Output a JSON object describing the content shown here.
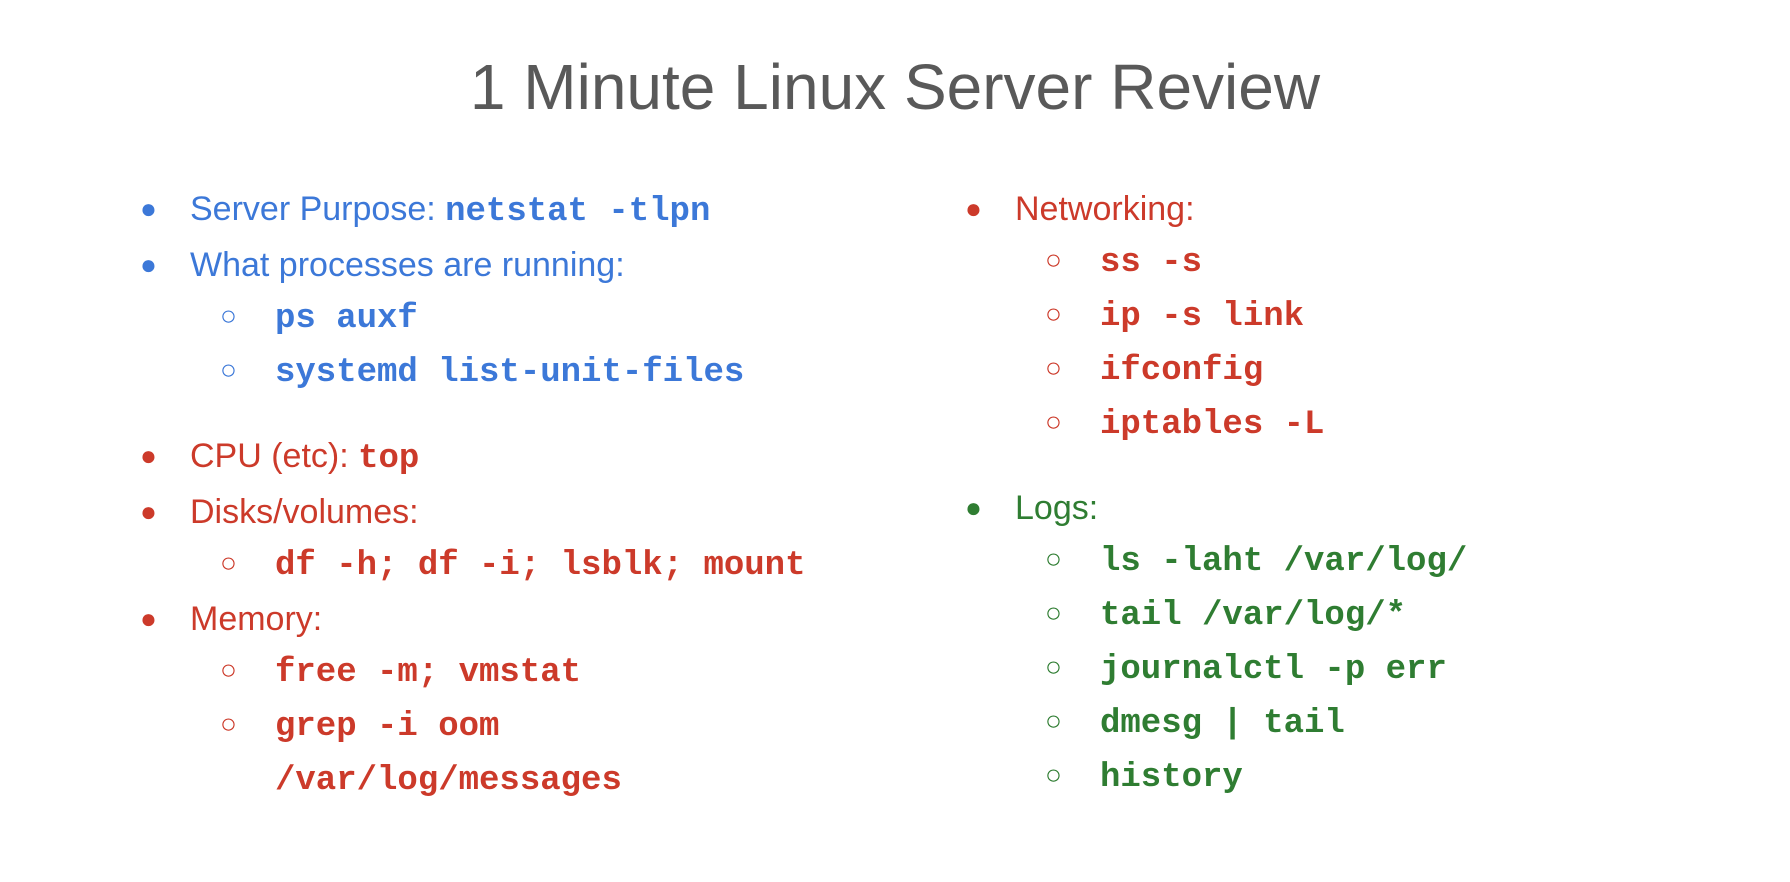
{
  "title": "1 Minute Linux Server Review",
  "colors": {
    "blue": "#3c78d8",
    "red": "#cc3a2a",
    "green": "#2f7d32",
    "title_gray": "#595959"
  },
  "left": {
    "blue": {
      "server_purpose_label": "Server Purpose: ",
      "server_purpose_cmd": "netstat -tlpn",
      "processes_label": "What processes are running:",
      "processes_cmds": {
        "ps": "ps auxf",
        "systemd": "systemd list-unit-files"
      }
    },
    "red": {
      "cpu_label": "CPU (etc): ",
      "cpu_cmd": "top",
      "disks_label": "Disks/volumes:",
      "disks_cmd": "df -h; df -i; lsblk; mount",
      "memory_label": "Memory:",
      "memory_cmds": {
        "free": "free -m; vmstat",
        "grep": "grep -i oom /var/log/messages"
      }
    }
  },
  "right": {
    "red": {
      "networking_label": "Networking:",
      "networking_cmds": {
        "ss": "ss -s",
        "ip": "ip -s link",
        "ifconfig": "ifconfig",
        "iptables": "iptables -L"
      }
    },
    "green": {
      "logs_label": "Logs:",
      "logs_cmds": {
        "ls": "ls -laht /var/log/",
        "tail": "tail /var/log/*",
        "journalctl": "journalctl -p err",
        "dmesg": "dmesg | tail",
        "history": "history"
      }
    }
  }
}
